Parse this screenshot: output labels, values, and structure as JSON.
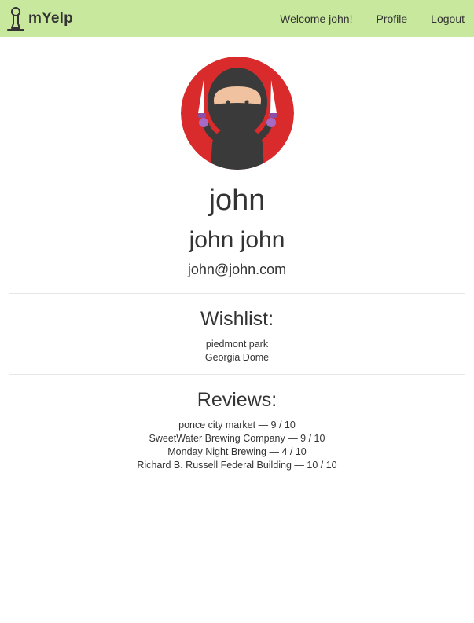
{
  "navbar": {
    "brand": "mYelp",
    "background": "#c8e89e",
    "brand_icon": "person-pin-icon",
    "links": [
      {
        "label": "Welcome john!"
      },
      {
        "label": "Profile"
      },
      {
        "label": "Logout"
      }
    ]
  },
  "profile": {
    "avatar_icon": "ninja-avatar-icon",
    "avatar_color": "#d92b2b",
    "username": "john",
    "full_name": "john john",
    "email": "john@john.com"
  },
  "wishlist": {
    "title": "Wishlist:",
    "items": [
      "piedmont park",
      "Georgia Dome"
    ]
  },
  "reviews": {
    "title": "Reviews:",
    "items": [
      "ponce city market — 9 / 10",
      "SweetWater Brewing Company — 9 / 10",
      "Monday Night Brewing — 4 / 10",
      "Richard B. Russell Federal Building — 10 / 10"
    ]
  }
}
